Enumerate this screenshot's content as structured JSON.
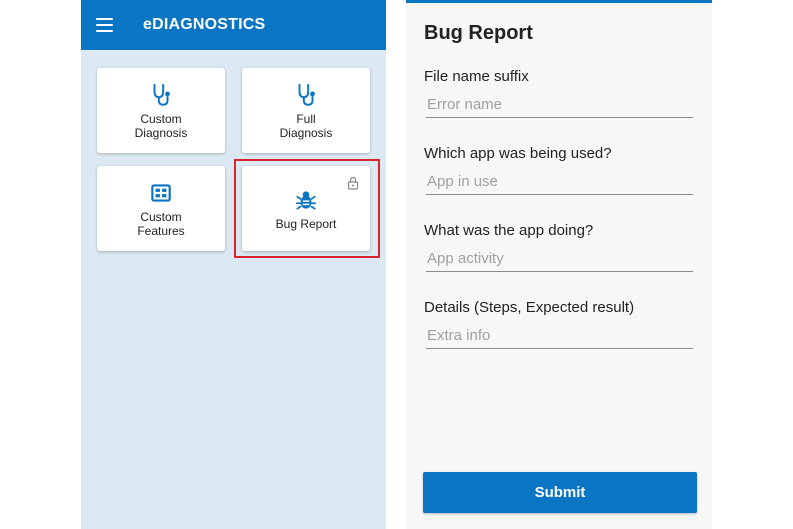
{
  "left_panel": {
    "app_title": "eDIAGNOSTICS",
    "menu_icon": "hamburger-menu-icon",
    "tiles": [
      {
        "label": "Custom\nDiagnosis",
        "icon": "stethoscope-icon"
      },
      {
        "label": "Full\nDiagnosis",
        "icon": "stethoscope-icon"
      },
      {
        "label": "Custom\nFeatures",
        "icon": "features-grid-icon"
      },
      {
        "label": "Bug Report",
        "icon": "bug-icon",
        "locked": true
      }
    ]
  },
  "right_panel": {
    "title": "Bug Report",
    "fields": [
      {
        "label": "File name suffix",
        "placeholder": "Error name"
      },
      {
        "label": "Which app was being used?",
        "placeholder": "App in use"
      },
      {
        "label": "What was the app doing?",
        "placeholder": "App activity"
      },
      {
        "label": "Details (Steps, Expected result)",
        "placeholder": "Extra info"
      }
    ],
    "submit_label": "Submit"
  },
  "colors": {
    "primary": "#0a75c2",
    "left_background": "#dce9f3",
    "highlight": "#d9232e"
  }
}
